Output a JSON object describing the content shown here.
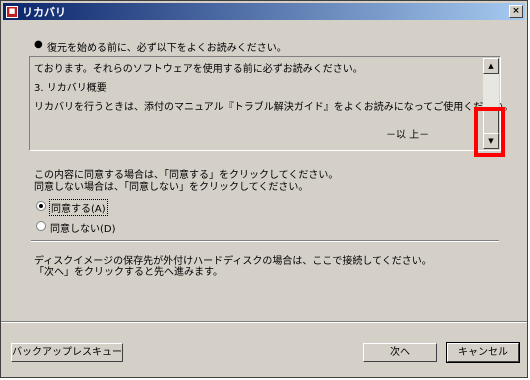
{
  "window": {
    "title": "リカバリ",
    "close_glyph": "×"
  },
  "notice": {
    "bullet": "●",
    "text": "復元を始める前に、必ず以下をよくお読みください。"
  },
  "textbox": {
    "lines": [
      "ております。それらのソフトウェアを使用する前に必ずお読みください。",
      "3. リカバリ概要",
      "リカバリを行うときは、添付のマニュアル『トラブル解決ガイド』をよくお読みになってご使用ください。"
    ],
    "end_mark": "－以 上－"
  },
  "agreement": {
    "line1": "この内容に同意する場合は、「同意する」をクリックしてください。",
    "line2": "同意しない場合は、「同意しない」をクリックしてください。",
    "options": [
      {
        "label": "同意する(A)",
        "selected": true
      },
      {
        "label": "同意しない(D)",
        "selected": false
      }
    ]
  },
  "disk_notice": {
    "line1": "ディスクイメージの保存先が外付けハードディスクの場合は、ここで接続してください。",
    "line2": "「次へ」をクリックすると先へ進みます。"
  },
  "buttons": {
    "backup": "バックアップレスキュー",
    "next": "次へ",
    "cancel": "キャンセル"
  },
  "colors": {
    "titlebar_start": "#0a246a",
    "titlebar_end": "#a6caf0",
    "highlight": "#ff0000",
    "face": "#d4d0c8"
  }
}
